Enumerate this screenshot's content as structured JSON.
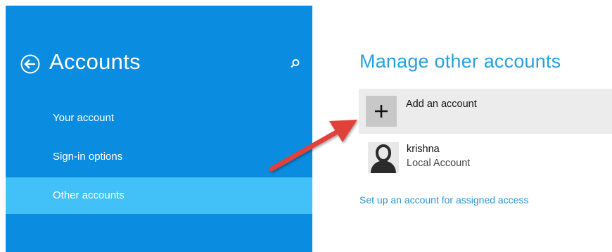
{
  "sidebar": {
    "title": "Accounts",
    "items": [
      {
        "label": "Your account"
      },
      {
        "label": "Sign-in options"
      },
      {
        "label": "Other accounts"
      }
    ],
    "selected_index": 2
  },
  "main": {
    "title": "Manage other accounts",
    "add_account_label": "Add an account",
    "accounts": [
      {
        "name": "krishna",
        "type": "Local Account"
      }
    ],
    "assigned_access_link": "Set up an account for assigned access"
  },
  "icons": {
    "back": "back-arrow-circle-icon",
    "search": "search-icon",
    "add": "plus-icon",
    "avatar": "user-silhouette-icon",
    "annotation": "red-arrow-annotation"
  },
  "colors": {
    "sidebar_bg": "#0a8ce0",
    "sidebar_selected": "#42c1f8",
    "main_title": "#28a0e0",
    "link": "#2b95d6",
    "add_row_bg": "#ececec",
    "annotation_arrow": "#e0433a"
  }
}
